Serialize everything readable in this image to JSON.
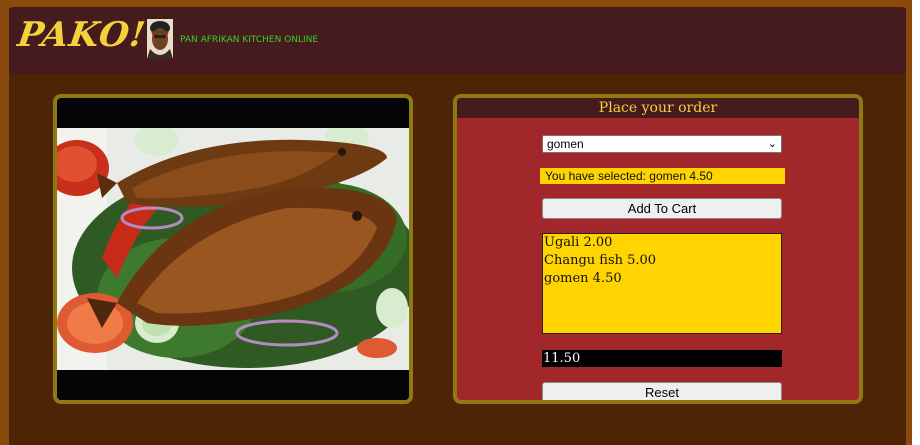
{
  "header": {
    "logo": "PAKO!",
    "tagline": "PAN AFRIKAN KITCHEN ONLINE"
  },
  "order": {
    "title": "Place your order",
    "selected_dish": "gomen",
    "selected_message": "You have selected: gomen 4.50",
    "add_button": "Add To Cart",
    "cart_items": [
      "Ugali 2.00",
      "Changu fish 5.00",
      "gomen 4.50"
    ],
    "total": "11.50",
    "reset_button": "Reset"
  },
  "colors": {
    "header_bg": "#461b1d",
    "logo": "#f4d23c",
    "tagline": "#36d12a",
    "panel_border": "#8f7a12",
    "order_bg": "#a1272a",
    "highlight": "#ffd400"
  },
  "icons": [
    "chef-face-icon",
    "chevron-down-icon"
  ]
}
